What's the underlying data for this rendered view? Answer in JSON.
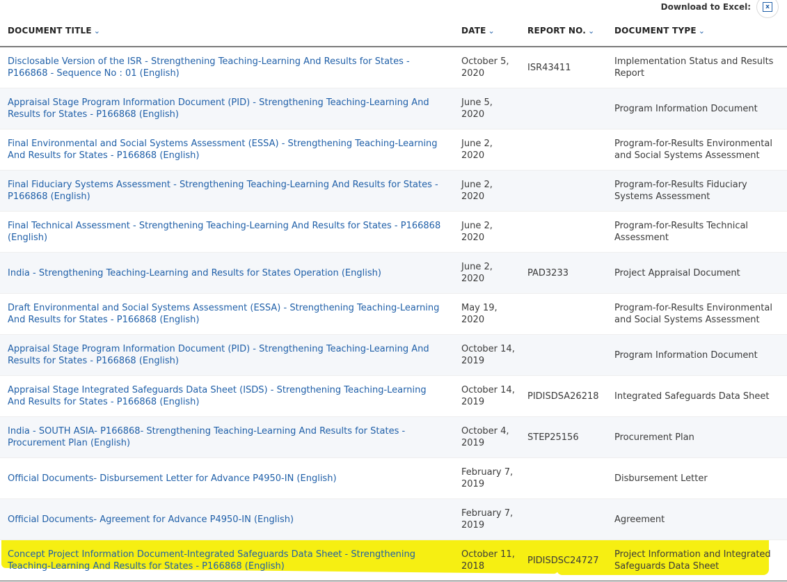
{
  "toolbar": {
    "download_label": "Download to Excel:"
  },
  "columns": {
    "title": "DOCUMENT TITLE",
    "date": "DATE",
    "report": "REPORT NO.",
    "type": "DOCUMENT TYPE"
  },
  "rows": [
    {
      "title": "Disclosable Version of the ISR - Strengthening Teaching-Learning And Results for States - P166868 - Sequence No : 01 (English)",
      "date": "October 5, 2020",
      "report": "ISR43411",
      "type": "Implementation Status and Results Report"
    },
    {
      "title": "Appraisal Stage Program Information Document (PID) - Strengthening Teaching-Learning And Results for States - P166868 (English)",
      "date": "June 5, 2020",
      "report": "",
      "type": "Program Information Document"
    },
    {
      "title": "Final Environmental and Social Systems Assessment (ESSA) - Strengthening Teaching-Learning And Results for States - P166868 (English)",
      "date": "June 2, 2020",
      "report": "",
      "type": "Program-for-Results Environmental and Social Systems Assessment"
    },
    {
      "title": "Final Fiduciary Systems Assessment - Strengthening Teaching-Learning And Results for States - P166868 (English)",
      "date": "June 2, 2020",
      "report": "",
      "type": "Program-for-Results Fiduciary Systems Assessment"
    },
    {
      "title": "Final Technical Assessment - Strengthening Teaching-Learning And Results for States - P166868 (English)",
      "date": "June 2, 2020",
      "report": "",
      "type": "Program-for-Results Technical Assessment"
    },
    {
      "title": "India - Strengthening Teaching-Learning and Results for States Operation (English)",
      "date": "June 2, 2020",
      "report": "PAD3233",
      "type": "Project Appraisal Document"
    },
    {
      "title": "Draft Environmental and Social Systems Assessment (ESSA) - Strengthening Teaching-Learning And Results for States - P166868 (English)",
      "date": "May 19, 2020",
      "report": "",
      "type": "Program-for-Results Environmental and Social Systems Assessment"
    },
    {
      "title": "Appraisal Stage Program Information Document (PID) - Strengthening Teaching-Learning And Results for States - P166868 (English)",
      "date": "October 14, 2019",
      "report": "",
      "type": "Program Information Document"
    },
    {
      "title": "Appraisal Stage Integrated Safeguards Data Sheet (ISDS) - Strengthening Teaching-Learning And Results for States - P166868 (English)",
      "date": "October 14, 2019",
      "report": "PIDISDSA26218",
      "type": "Integrated Safeguards Data Sheet"
    },
    {
      "title": "India - SOUTH ASIA- P166868- Strengthening Teaching-Learning And Results for States - Procurement Plan (English)",
      "date": "October 4, 2019",
      "report": "STEP25156",
      "type": "Procurement Plan"
    },
    {
      "title": "Official Documents- Disbursement Letter for Advance P4950-IN (English)",
      "date": "February 7, 2019",
      "report": "",
      "type": "Disbursement Letter"
    },
    {
      "title": "Official Documents- Agreement for Advance P4950-IN (English)",
      "date": "February 7, 2019",
      "report": "",
      "type": "Agreement"
    },
    {
      "title": "Concept Project Information Document-Integrated Safeguards Data Sheet - Strengthening Teaching-Learning And Results for States - P166868 (English)",
      "date": "October 11, 2018",
      "report": "PIDISDSC24727",
      "type": "Project Information and Integrated Safeguards Data Sheet"
    }
  ],
  "colors": {
    "link": "#1f5fa8",
    "highlight": "#f6ef12",
    "alt_row": "#f5f7fa"
  }
}
